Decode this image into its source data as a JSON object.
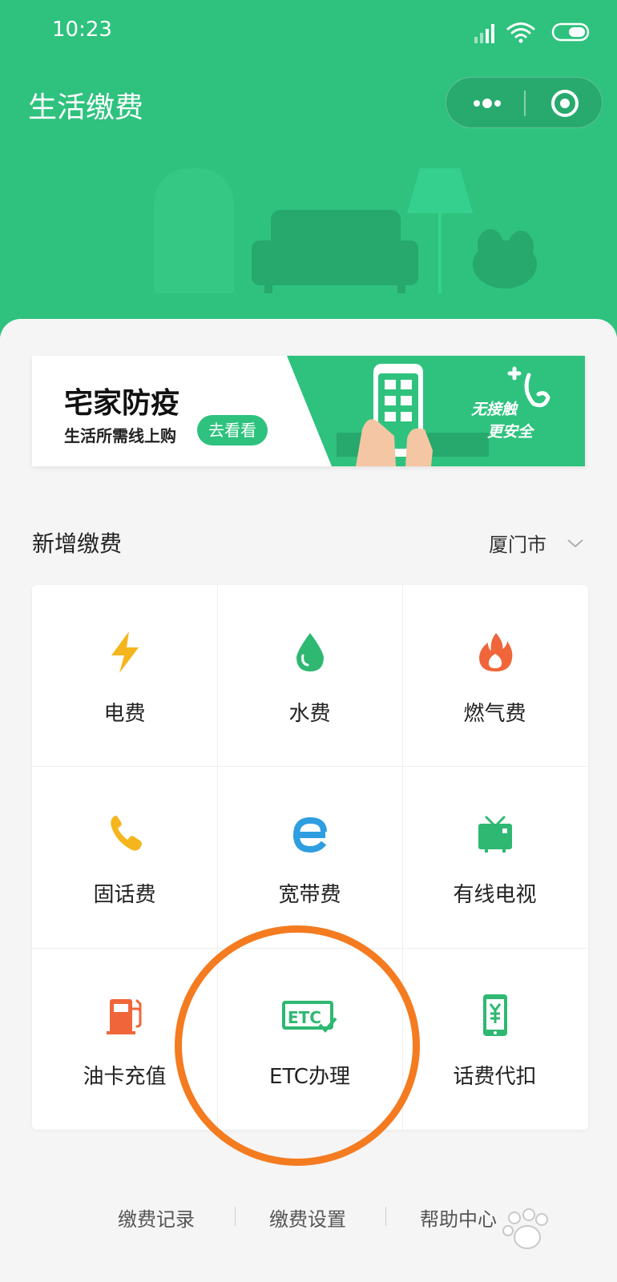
{
  "status_bar": {
    "time": "10:23"
  },
  "app": {
    "title": "生活缴费"
  },
  "banner": {
    "title": "宅家防疫",
    "subtitle": "生活所需线上购",
    "button": "去看看",
    "slogan_line1": "无接触",
    "slogan_line2": "更安全"
  },
  "section": {
    "title": "新增缴费",
    "city": "厦门市"
  },
  "services": [
    {
      "label": "电费",
      "icon": "lightning-icon",
      "color": "#f5b51c"
    },
    {
      "label": "水费",
      "icon": "water-drop-icon",
      "color": "#2eb872"
    },
    {
      "label": "燃气费",
      "icon": "flame-icon",
      "color": "#f0663a"
    },
    {
      "label": "固话费",
      "icon": "phone-icon",
      "color": "#f5b51c"
    },
    {
      "label": "宽带费",
      "icon": "broadband-e-icon",
      "color": "#2f9ee0"
    },
    {
      "label": "有线电视",
      "icon": "tv-icon",
      "color": "#2eb872"
    },
    {
      "label": "油卡充值",
      "icon": "fuel-pump-icon",
      "color": "#f0663a"
    },
    {
      "label": "ETC办理",
      "icon": "etc-icon",
      "color": "#2eb872"
    },
    {
      "label": "话费代扣",
      "icon": "mobile-yuan-icon",
      "color": "#2eb872"
    }
  ],
  "footer": {
    "record": "缴费记录",
    "settings": "缴费设置",
    "help": "帮助中心"
  },
  "colors": {
    "brand": "#2ec27e",
    "highlight_circle": "#f47b20"
  }
}
